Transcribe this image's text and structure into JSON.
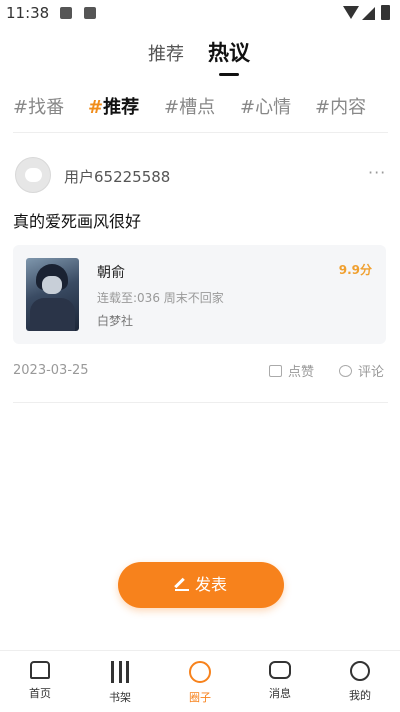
{
  "status_bar": {
    "time": "11:38"
  },
  "top_nav": {
    "tabs": [
      "推荐",
      "热议"
    ],
    "active": "热议"
  },
  "tags": {
    "items": [
      {
        "hash": "#",
        "label": "找番"
      },
      {
        "hash": "#",
        "label": "推荐"
      },
      {
        "hash": "#",
        "label": "槽点"
      },
      {
        "hash": "#",
        "label": "心情"
      },
      {
        "hash": "#",
        "label": "内容"
      }
    ],
    "active_index": 1
  },
  "post": {
    "username": "用户65225588",
    "more": "···",
    "content": "真的爱死画风很好",
    "book": {
      "title": "朝俞",
      "chapter": "连载至:036 周末不回家",
      "author": "白梦社",
      "score": "9.9分"
    },
    "date": "2023-03-25",
    "like_label": "点赞",
    "comment_label": "评论"
  },
  "publish_button": {
    "label": "发表"
  },
  "tab_bar": {
    "items": [
      {
        "label": "首页",
        "icon": "home-icon"
      },
      {
        "label": "书架",
        "icon": "bookshelf-icon"
      },
      {
        "label": "圈子",
        "icon": "circle-icon"
      },
      {
        "label": "消息",
        "icon": "message-icon"
      },
      {
        "label": "我的",
        "icon": "profile-icon"
      }
    ],
    "active_index": 2
  },
  "colors": {
    "accent": "#f7821c",
    "score": "#f0a030"
  }
}
